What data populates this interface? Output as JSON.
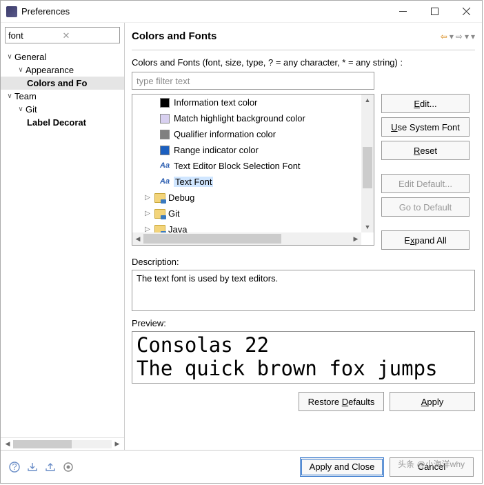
{
  "window": {
    "title": "Preferences"
  },
  "sidebar": {
    "filter_value": "font",
    "items": [
      {
        "label": "General",
        "level": 1,
        "expanded": true
      },
      {
        "label": "Appearance",
        "level": 2,
        "expanded": true
      },
      {
        "label": "Colors and Fo",
        "level": 3,
        "selected": true
      },
      {
        "label": "Team",
        "level": 1,
        "expanded": true
      },
      {
        "label": "Git",
        "level": 2,
        "expanded": true
      },
      {
        "label": "Label Decorat",
        "level": 3,
        "bold": true
      }
    ]
  },
  "header": {
    "title": "Colors and Fonts"
  },
  "content": {
    "prompt": "Colors and Fonts (font, size, type, ? = any character, * = any string) :",
    "filter_placeholder": "type filter text",
    "list": [
      {
        "kind": "color",
        "swatch": "#000000",
        "label": "Information text color"
      },
      {
        "kind": "color",
        "swatch": "#d8d0f0",
        "label": "Match highlight background color"
      },
      {
        "kind": "color",
        "swatch": "#808080",
        "label": "Qualifier information color"
      },
      {
        "kind": "color",
        "swatch": "#1b5fbf",
        "label": "Range indicator color"
      },
      {
        "kind": "font",
        "label": "Text Editor Block Selection Font",
        "mono": true
      },
      {
        "kind": "font",
        "label": "Text Font",
        "mono": true,
        "selected": true
      },
      {
        "kind": "folder",
        "label": "Debug"
      },
      {
        "kind": "folder",
        "label": "Git"
      },
      {
        "kind": "folder",
        "label": "Java"
      }
    ],
    "buttons": {
      "edit": "Edit...",
      "use_system_font": "Use System Font",
      "reset": "Reset",
      "edit_default": "Edit Default...",
      "go_to_default": "Go to Default",
      "expand_all": "Expand All"
    },
    "description_label": "Description:",
    "description_text": "The text font is used by text editors.",
    "preview_label": "Preview:",
    "preview_lines": [
      "Consolas 22",
      "The quick brown fox jumps"
    ],
    "restore_defaults": "Restore Defaults",
    "apply": "Apply"
  },
  "footer": {
    "apply_close": "Apply and Close",
    "cancel": "Cancel"
  },
  "watermark": "头条 @小海洋why"
}
